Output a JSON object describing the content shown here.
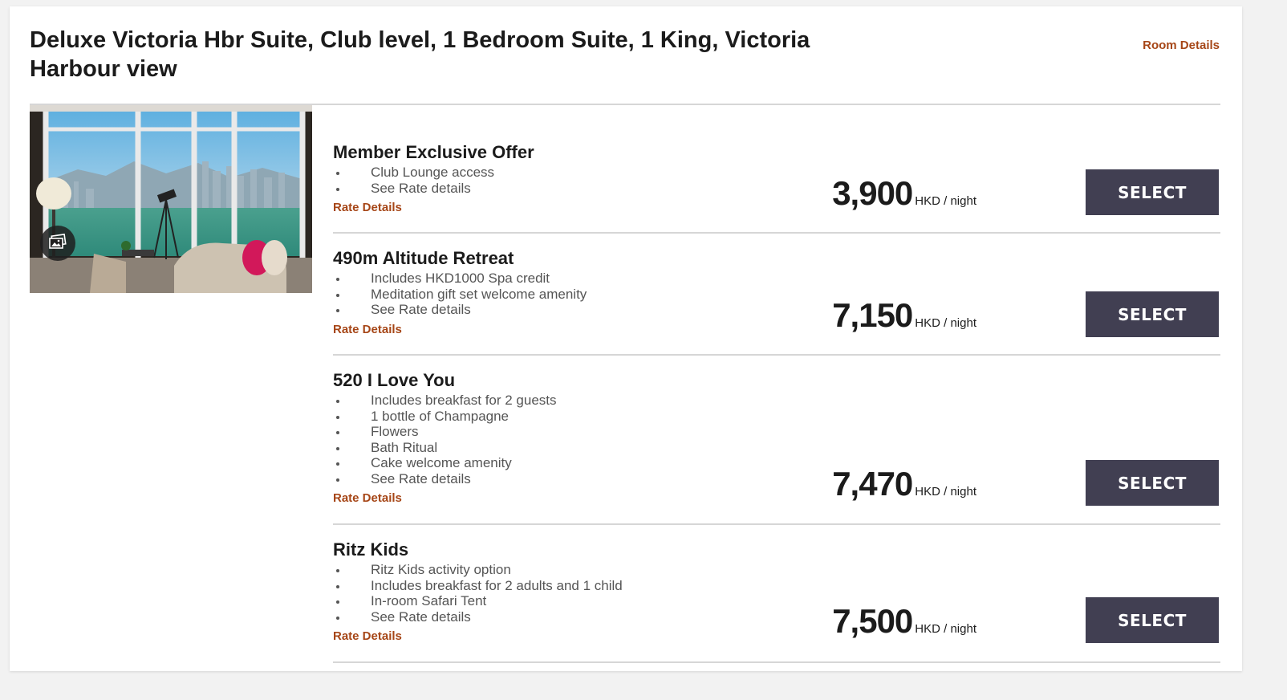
{
  "room": {
    "title": "Deluxe Victoria Hbr Suite, Club level, 1 Bedroom Suite, 1 King, Victoria Harbour view",
    "details_link": "Room Details",
    "photo_alt": "Suite with floor-to-ceiling windows overlooking Victoria Harbour"
  },
  "colors": {
    "accent_link": "#a64617",
    "button_bg": "#413f52",
    "button_text": "#ffffff"
  },
  "icons": {
    "gallery": "gallery-icon"
  },
  "rates": [
    {
      "name": "Member Exclusive Offer",
      "perks": [
        "Club Lounge access",
        "See Rate details"
      ],
      "details_link": "Rate Details",
      "price": "3,900",
      "unit": "HKD / night",
      "button": "SELECT"
    },
    {
      "name": "490m Altitude Retreat",
      "perks": [
        "Includes HKD1000 Spa credit",
        "Meditation gift set welcome amenity",
        "See Rate details"
      ],
      "details_link": "Rate Details",
      "price": "7,150",
      "unit": "HKD / night",
      "button": "SELECT"
    },
    {
      "name": "520 I Love You",
      "perks": [
        "Includes breakfast for 2 guests",
        "1 bottle of Champagne",
        "Flowers",
        "Bath Ritual",
        "Cake welcome amenity",
        "See Rate details"
      ],
      "details_link": "Rate Details",
      "price": "7,470",
      "unit": "HKD / night",
      "button": "SELECT"
    },
    {
      "name": "Ritz Kids",
      "perks": [
        "Ritz Kids activity option",
        "Includes breakfast for 2 adults and 1 child",
        "In-room Safari Tent",
        "See Rate details"
      ],
      "details_link": "Rate Details",
      "price": "7,500",
      "unit": "HKD / night",
      "button": "SELECT"
    }
  ]
}
